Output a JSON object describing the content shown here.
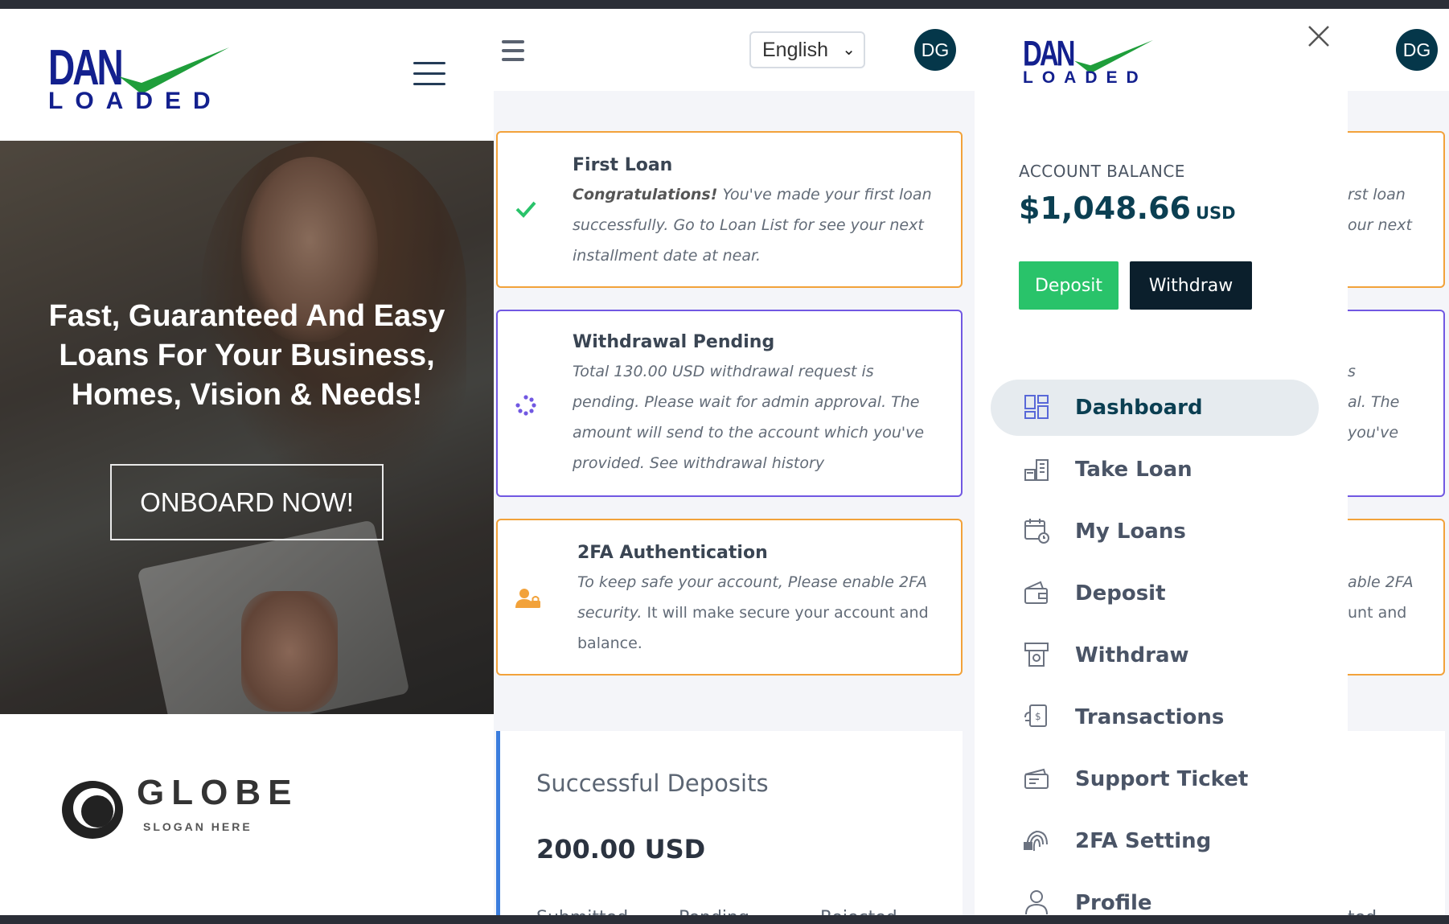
{
  "brand": {
    "logo_top": "DAN",
    "logo_bottom": "LOADED"
  },
  "colors": {
    "brand_blue": "#13208e",
    "check_green": "#1f9e3b",
    "primary": "#05374a",
    "success": "#29c36a",
    "warning": "#f2a23a",
    "info": "#7158e2"
  },
  "landing": {
    "hero_title": "Fast, Guaranteed And Easy Loans For Your Business, Homes, Vision & Needs!",
    "cta": "ONBOARD NOW!",
    "partner": {
      "name": "GLOBE",
      "slogan": "SLOGAN HERE"
    }
  },
  "header": {
    "language": "English",
    "avatar": "DG"
  },
  "alerts": [
    {
      "title": "First Loan",
      "lead": "Congratulations!",
      "lines": [
        " You've made your first loan",
        "successfully. Go to Loan List for see your next",
        "installment date at near."
      ],
      "icon": "check-icon"
    },
    {
      "title": "Withdrawal Pending",
      "lines": [
        "Total 130.00 USD withdrawal request is",
        "pending. Please wait for admin approval. The",
        "amount will send to the account which you've",
        "provided. See withdrawal history"
      ],
      "icon": "spinner-icon"
    },
    {
      "title": "2FA Authentication",
      "italic": "To keep safe your account, Please enable 2FA",
      "italic2": "security.",
      "rest2": " It will make secure your account and",
      "rest3": "balance.",
      "icon": "user-lock-icon"
    }
  ],
  "deposits_card": {
    "title": "Successful Deposits",
    "value": "200.00 USD",
    "columns": [
      "Submitted",
      "Pending",
      "Rejected"
    ]
  },
  "sidebar": {
    "balance_label": "ACCOUNT BALANCE",
    "balance_value": "$1,048.66",
    "balance_currency": "USD",
    "deposit_button": "Deposit",
    "withdraw_button": "Withdraw",
    "items": [
      {
        "label": "Dashboard",
        "icon": "dashboard-icon",
        "active": true
      },
      {
        "label": "Take Loan",
        "icon": "take-loan-icon"
      },
      {
        "label": "My Loans",
        "icon": "calendar-icon"
      },
      {
        "label": "Deposit",
        "icon": "wallet-icon"
      },
      {
        "label": "Withdraw",
        "icon": "atm-icon"
      },
      {
        "label": "Transactions",
        "icon": "transactions-icon"
      },
      {
        "label": "Support Ticket",
        "icon": "ticket-icon"
      },
      {
        "label": "2FA Setting",
        "icon": "fingerprint-icon"
      },
      {
        "label": "Profile",
        "icon": "user-icon"
      }
    ]
  },
  "peek": {
    "lines": [
      "rst loan",
      "our next",
      "s",
      "al. The",
      "you've",
      "able 2FA",
      "unt and",
      "ted"
    ]
  }
}
